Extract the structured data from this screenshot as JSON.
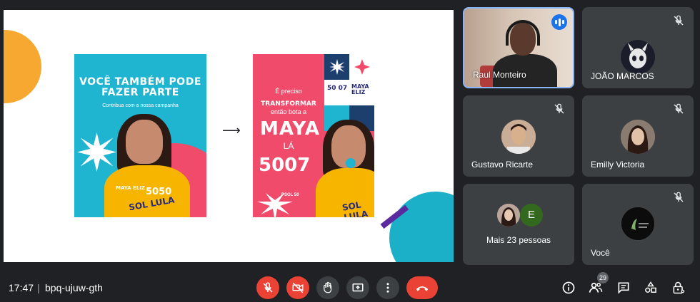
{
  "presentation": {
    "poster1": {
      "headline": "VOCÊ TAMBÉM PODE FAZER PARTE",
      "subline": "Contribua com a nossa campanha",
      "candidate": "MAYA ELIZ",
      "number": "5050",
      "slogan": "SOL LULA"
    },
    "arrow": "⟶",
    "poster2": {
      "line1": "É preciso",
      "line2": "TRANSFORMAR",
      "line3": "então bota a",
      "name": "MAYA",
      "la": "LÁ",
      "number": "5007",
      "party": "PSOL 50",
      "slogan": "SOL LULA",
      "grid_number": "50 07",
      "grid_name": "MAYA ELIZ"
    }
  },
  "participants": [
    {
      "name": "Raul Monteiro",
      "speaking": true
    },
    {
      "name": "JOÃO MARCOS",
      "muted": true
    },
    {
      "name": "Gustavo Ricarte",
      "muted": true
    },
    {
      "name": "Emilly Victoria",
      "muted": true
    },
    {
      "name": "Mais 23 pessoas",
      "avatar_letter": "E"
    },
    {
      "name": "Você",
      "muted": true
    }
  ],
  "bottombar": {
    "time": "17:47",
    "separator": "|",
    "meeting_code": "bpq-ujuw-gth",
    "people_count": "29"
  },
  "colors": {
    "background": "#202124",
    "tile": "#3c4043",
    "danger": "#ea4335",
    "accent": "#8ab4f8"
  }
}
